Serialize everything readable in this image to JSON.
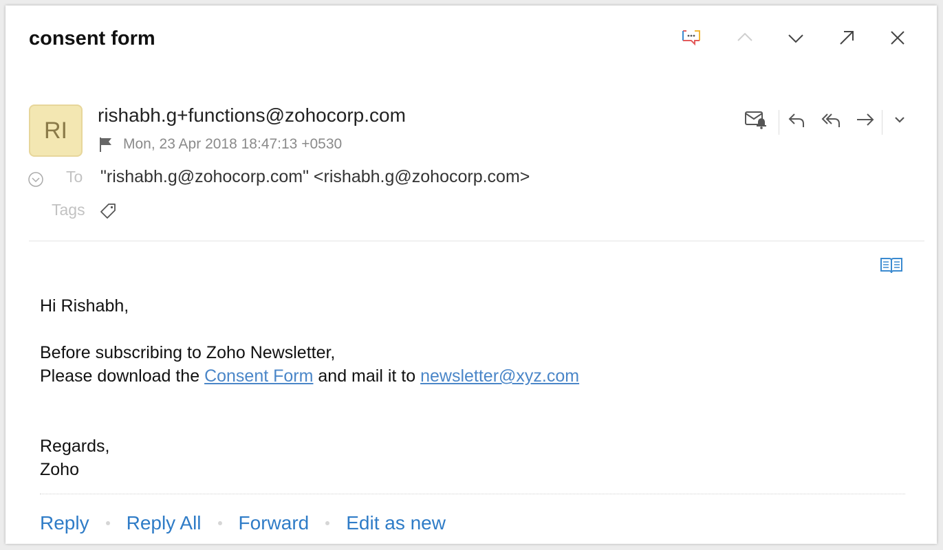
{
  "email": {
    "subject": "consent form",
    "sender": "rishabh.g+functions@zohocorp.com",
    "avatar_initials": "RI",
    "date": "Mon, 23 Apr 2018 18:47:13 +0530",
    "to_label": "To",
    "to_value": "\"rishabh.g@zohocorp.com\" <rishabh.g@zohocorp.com>",
    "tags_label": "Tags",
    "body": {
      "greeting": "Hi Rishabh,",
      "line1": "Before subscribing to Zoho Newsletter,",
      "line2_prefix": "Please download the ",
      "consent_link": "Consent Form",
      "line2_mid": " and mail it to ",
      "email_link": "newsletter@xyz.com",
      "regards": "Regards,",
      "signature": "Zoho"
    }
  },
  "footer": {
    "reply": "Reply",
    "reply_all": "Reply All",
    "forward": "Forward",
    "edit_as_new": "Edit as new"
  },
  "icons": {
    "top": [
      "comment-icon",
      "chevron-up-icon",
      "chevron-down-icon",
      "pop-out-icon",
      "close-icon"
    ],
    "actions": [
      "mail-reminder-icon",
      "reply-icon",
      "reply-all-icon",
      "forward-icon",
      "more-chevron-icon"
    ],
    "other": [
      "flag-icon",
      "expand-details-icon",
      "tag-icon",
      "reading-mode-icon"
    ]
  },
  "colors": {
    "avatar_bg": "#f3e7b2",
    "link": "#4a86c8",
    "footer_link": "#2f7cc7",
    "reading_icon": "#3a8ad0"
  }
}
